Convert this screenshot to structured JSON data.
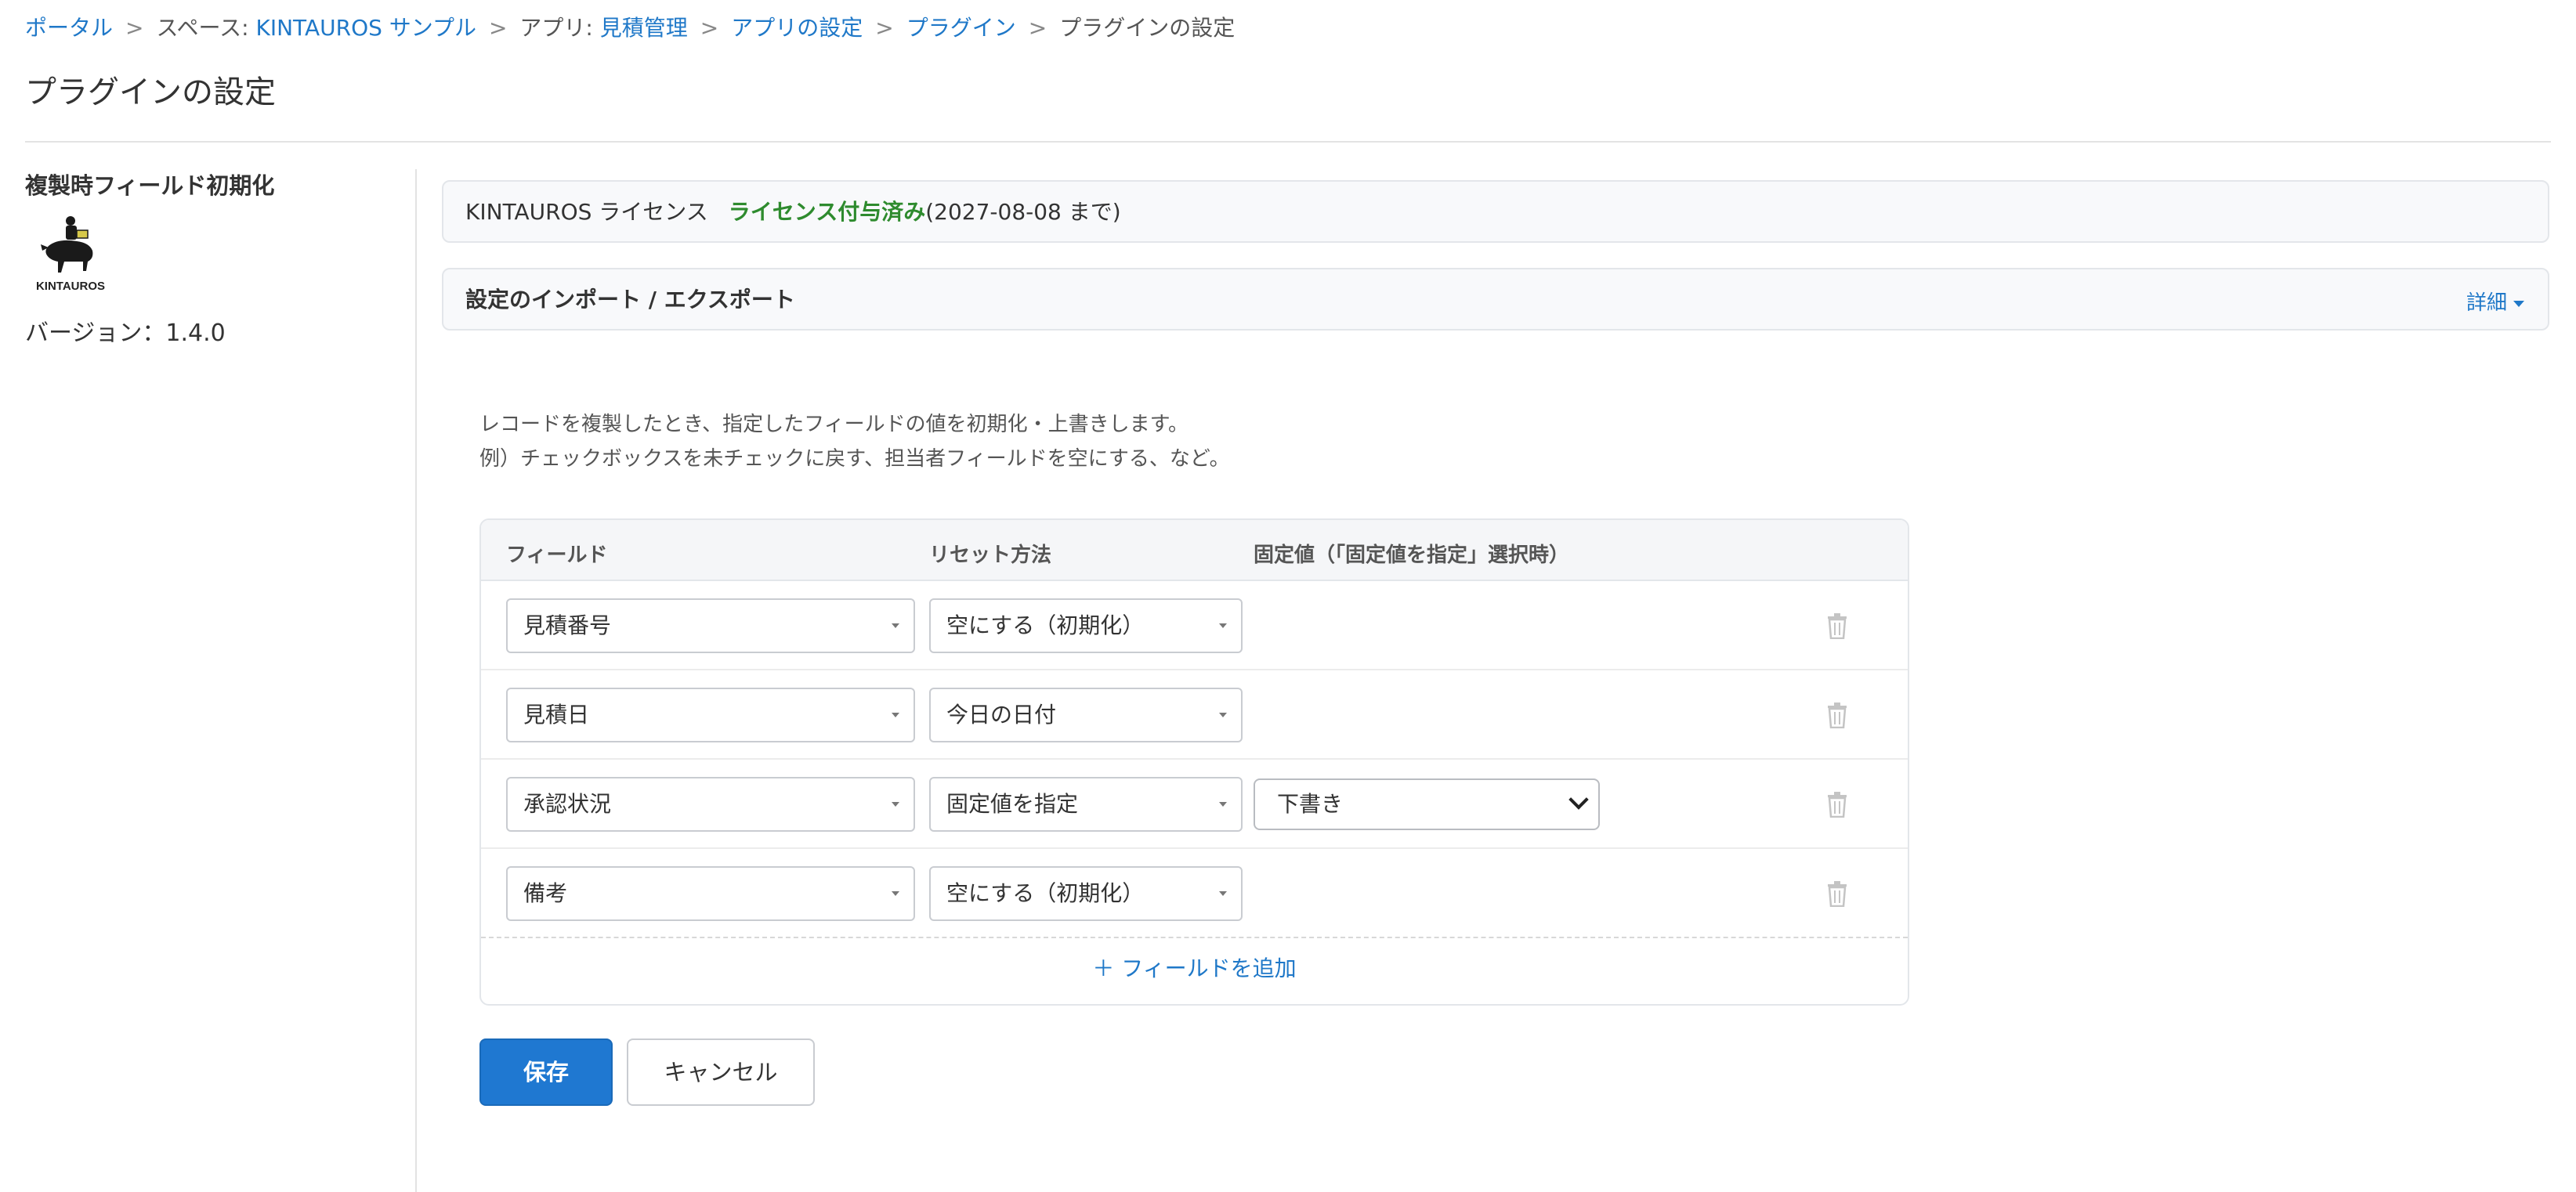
{
  "breadcrumb": {
    "portal": "ポータル",
    "space_prefix": "スペース: ",
    "space": "KINTAUROS サンプル",
    "app_prefix": "アプリ: ",
    "app": "見積管理",
    "app_settings": "アプリの設定",
    "plugins": "プラグイン",
    "current": "プラグインの設定",
    "separator": ">"
  },
  "page_title": "プラグインの設定",
  "sidebar": {
    "plugin_name": "複製時フィールド初期化",
    "logo_text": "KINTAUROS",
    "version": "バージョン：1.4.0"
  },
  "license": {
    "title": "KINTAUROS ライセンス",
    "status": "ライセンス付与済み",
    "expiry": "(2027-08-08 まで)"
  },
  "import_export": {
    "title": "設定のインポート / エクスポート",
    "detail_label": "詳細"
  },
  "description": {
    "line1": "レコードを複製したとき、指定したフィールドの値を初期化・上書きします。",
    "line2": "例）チェックボックスを未チェックに戻す、担当者フィールドを空にする、など。"
  },
  "table": {
    "headers": {
      "field": "フィールド",
      "reset": "リセット方法",
      "fixed": "固定値（「固定値を指定」選択時）"
    },
    "rows": [
      {
        "field": "見積番号",
        "reset": "空にする（初期化）",
        "fixed": ""
      },
      {
        "field": "見積日",
        "reset": "今日の日付",
        "fixed": ""
      },
      {
        "field": "承認状況",
        "reset": "固定値を指定",
        "fixed": "下書き"
      },
      {
        "field": "備考",
        "reset": "空にする（初期化）",
        "fixed": ""
      }
    ],
    "add_label": "＋ フィールドを追加"
  },
  "buttons": {
    "save": "保存",
    "cancel": "キャンセル"
  },
  "colors": {
    "link": "#1f78c8",
    "license_ok": "#2e8b2e",
    "primary": "#1f78d1"
  }
}
